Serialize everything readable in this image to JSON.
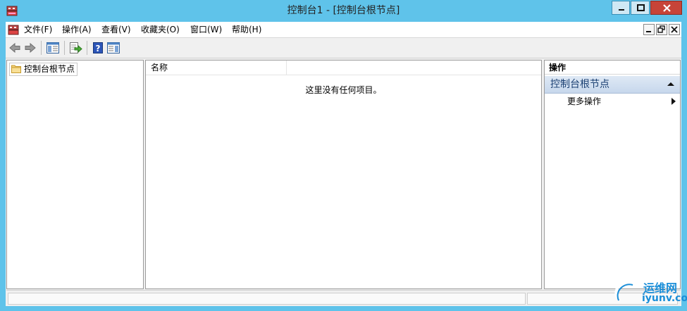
{
  "window": {
    "title": "控制台1 - [控制台根节点]"
  },
  "menu": {
    "items": [
      "文件(F)",
      "操作(A)",
      "查看(V)",
      "收藏夹(O)",
      "窗口(W)",
      "帮助(H)"
    ]
  },
  "toolbar": {
    "buttons": [
      "back-arrow-icon",
      "forward-arrow-icon",
      "show-hide-tree-icon",
      "export-list-icon",
      "help-icon",
      "show-hide-action-pane-icon"
    ]
  },
  "tree": {
    "root_label": "控制台根节点"
  },
  "list": {
    "column_name": "名称",
    "empty_message": "这里没有任何项目。"
  },
  "actions": {
    "header": "操作",
    "section_title": "控制台根节点",
    "items": [
      "更多操作"
    ]
  },
  "watermark": {
    "line1": "运维网",
    "line2": "iyunv.com"
  }
}
